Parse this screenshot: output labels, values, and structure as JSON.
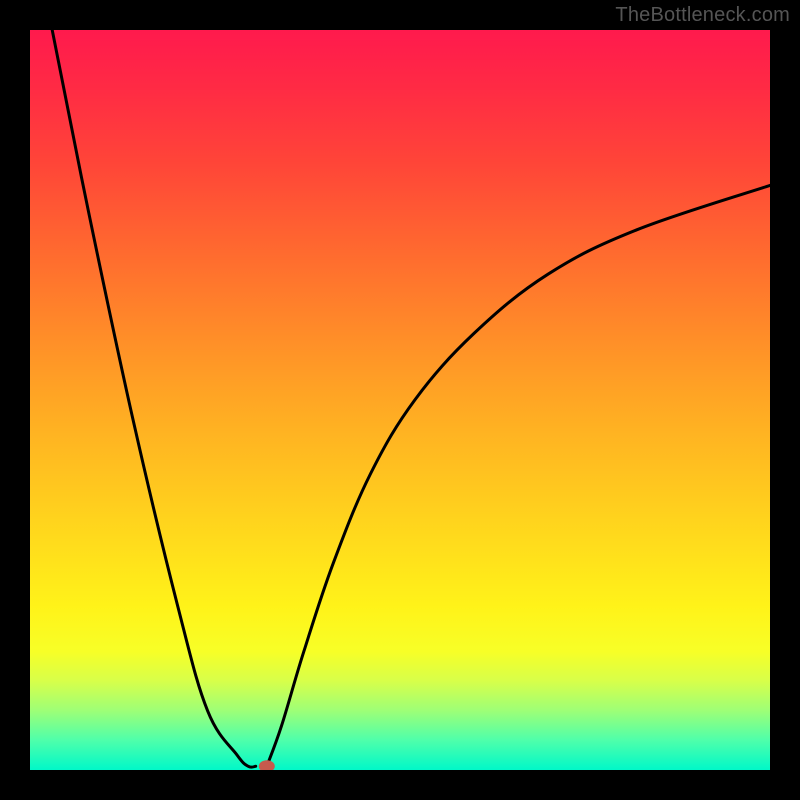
{
  "watermark": "TheBottleneck.com",
  "chart_data": {
    "type": "line",
    "title": "",
    "xlabel": "",
    "ylabel": "",
    "xlim": [
      0,
      100
    ],
    "ylim": [
      0,
      100
    ],
    "left_segment": {
      "x": [
        3,
        8,
        14,
        20,
        24,
        28,
        29.5,
        30.5
      ],
      "y": [
        100,
        75,
        47,
        22,
        8,
        2,
        0.5,
        0.5
      ]
    },
    "right_segment": {
      "x": [
        32,
        34,
        37,
        41,
        46,
        52,
        60,
        70,
        82,
        100
      ],
      "y": [
        0.5,
        6,
        16,
        28,
        40,
        50,
        59,
        67,
        73,
        79
      ]
    },
    "marker": {
      "x": 32,
      "y": 0.5
    },
    "series": [
      {
        "name": "bottleneck-curve"
      }
    ]
  }
}
